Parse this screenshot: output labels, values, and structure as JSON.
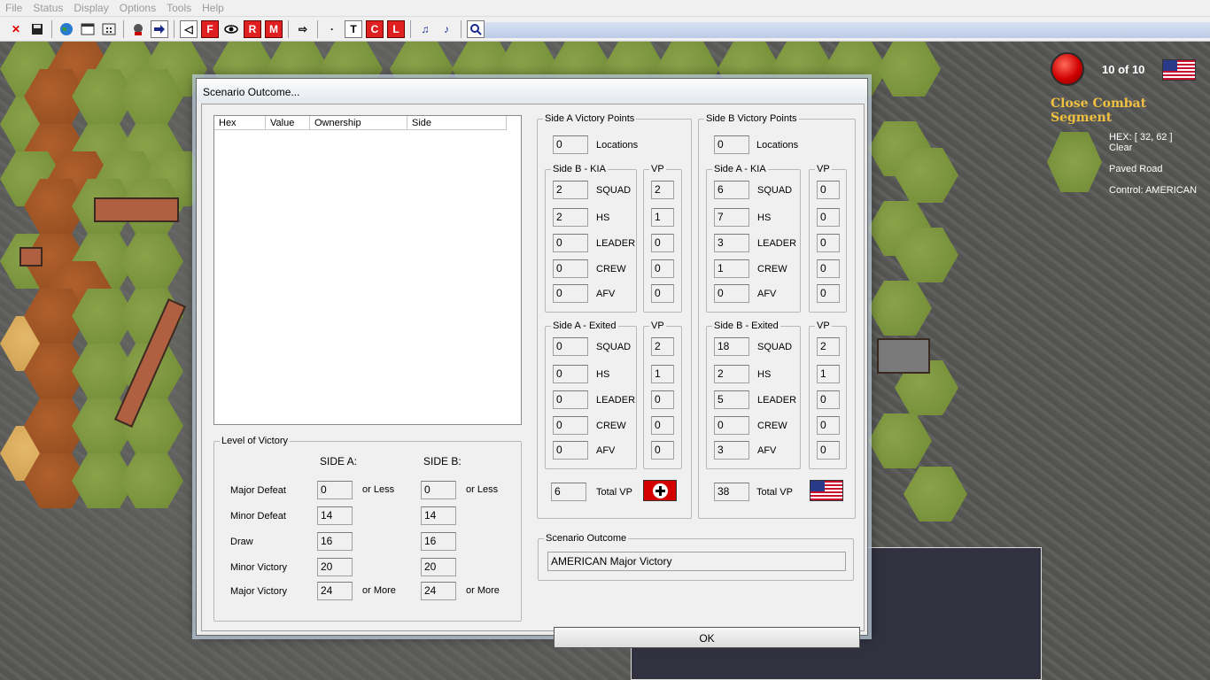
{
  "menu": [
    "File",
    "Status",
    "Display",
    "Options",
    "Tools",
    "Help"
  ],
  "toolbar": {
    "close_glyph": "✕",
    "pan_glyph": "◁",
    "dot_glyph": "·",
    "next_glyph": "⇨",
    "f_label": "F",
    "r_label": "R",
    "m_label": "M",
    "t_label": "T",
    "c_label": "C",
    "l_label": "L",
    "music_glyph": "♫",
    "note_glyph": "♪"
  },
  "status_panel": {
    "turn": "10 of 10",
    "phase": "Close Combat Segment",
    "hex_coords": "HEX: [ 32, 62 ]",
    "terrain": "Clear",
    "road": "Paved Road",
    "control": "Control: AMERICAN"
  },
  "dialog": {
    "title": "Scenario Outcome...",
    "list_headers": [
      "Hex",
      "Value",
      "Ownership",
      "Side"
    ],
    "level": {
      "title": "Level of Victory",
      "side_a_header": "SIDE A:",
      "side_b_header": "SIDE B:",
      "rows": [
        {
          "label": "Major Defeat",
          "a": "0",
          "b": "0",
          "suffix": "or Less"
        },
        {
          "label": "Minor Defeat",
          "a": "14",
          "b": "14",
          "suffix": ""
        },
        {
          "label": "Draw",
          "a": "16",
          "b": "16",
          "suffix": ""
        },
        {
          "label": "Minor Victory",
          "a": "20",
          "b": "20",
          "suffix": ""
        },
        {
          "label": "Major Victory",
          "a": "24",
          "b": "24",
          "suffix": "or More"
        }
      ]
    },
    "side_a": {
      "title": "Side A Victory Points",
      "locations": "0",
      "locations_label": "Locations",
      "kia_title": "Side B - KIA",
      "vp_title": "VP",
      "kia": [
        {
          "label": "SQUAD",
          "n": "2",
          "vp": "2"
        },
        {
          "label": "HS",
          "n": "2",
          "vp": "1"
        },
        {
          "label": "LEADER",
          "n": "0",
          "vp": "0"
        },
        {
          "label": "CREW",
          "n": "0",
          "vp": "0"
        },
        {
          "label": "AFV",
          "n": "0",
          "vp": "0"
        }
      ],
      "exited_title": "Side A - Exited",
      "exited": [
        {
          "label": "SQUAD",
          "n": "0",
          "vp": "2"
        },
        {
          "label": "HS",
          "n": "0",
          "vp": "1"
        },
        {
          "label": "LEADER",
          "n": "0",
          "vp": "0"
        },
        {
          "label": "CREW",
          "n": "0",
          "vp": "0"
        },
        {
          "label": "AFV",
          "n": "0",
          "vp": "0"
        }
      ],
      "total": "6",
      "total_label": "Total VP"
    },
    "side_b": {
      "title": "Side B Victory Points",
      "locations": "0",
      "locations_label": "Locations",
      "kia_title": "Side A - KIA",
      "vp_title": "VP",
      "kia": [
        {
          "label": "SQUAD",
          "n": "6",
          "vp": "0"
        },
        {
          "label": "HS",
          "n": "7",
          "vp": "0"
        },
        {
          "label": "LEADER",
          "n": "3",
          "vp": "0"
        },
        {
          "label": "CREW",
          "n": "1",
          "vp": "0"
        },
        {
          "label": "AFV",
          "n": "0",
          "vp": "0"
        }
      ],
      "exited_title": "Side B - Exited",
      "exited": [
        {
          "label": "SQUAD",
          "n": "18",
          "vp": "2"
        },
        {
          "label": "HS",
          "n": "2",
          "vp": "1"
        },
        {
          "label": "LEADER",
          "n": "5",
          "vp": "0"
        },
        {
          "label": "CREW",
          "n": "0",
          "vp": "0"
        },
        {
          "label": "AFV",
          "n": "3",
          "vp": "0"
        }
      ],
      "total": "38",
      "total_label": "Total VP"
    },
    "outcome": {
      "title": "Scenario Outcome",
      "value": "AMERICAN Major Victory"
    },
    "ok_label": "OK"
  }
}
